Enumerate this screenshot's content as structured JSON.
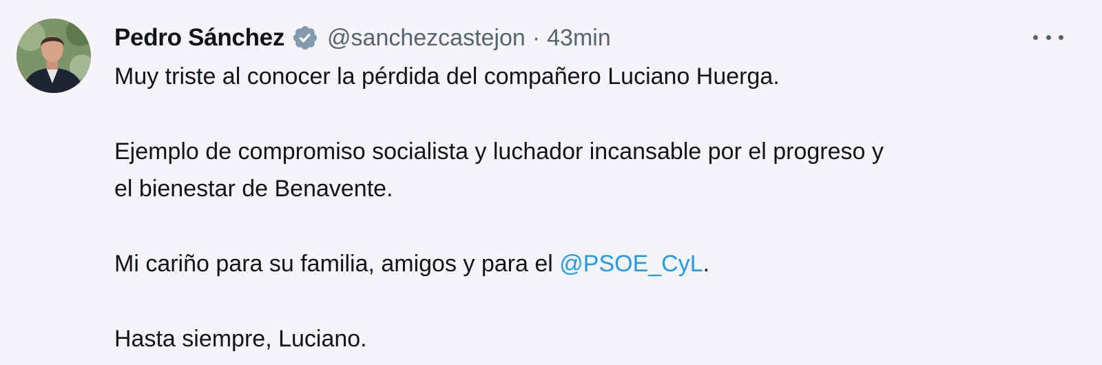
{
  "author": {
    "display_name": "Pedro Sánchez",
    "handle": "@sanchezcastejon",
    "separator": "·",
    "time": "43min",
    "verified": true,
    "avatar": "profile-photo"
  },
  "tweet": {
    "line1": "Muy triste al conocer la pérdida del compañero Luciano Huerga.",
    "line2": "Ejemplo de compromiso socialista y luchador incansable por el progreso y",
    "line3": "el bienestar de Benavente.",
    "line4_prefix": "Mi cariño para su familia, amigos y para el ",
    "line4_mention": "@PSOE_CyL",
    "line4_suffix": ".",
    "line5": "Hasta siempre, Luciano."
  },
  "icons": {
    "verified_badge": "verified-badge-icon",
    "more_options": "more-options-icon"
  },
  "colors": {
    "background": "#f6f4f8",
    "text": "#0f1419",
    "secondary_text": "#536471",
    "link": "#1d9bf0",
    "verified_badge": "#829aab"
  }
}
